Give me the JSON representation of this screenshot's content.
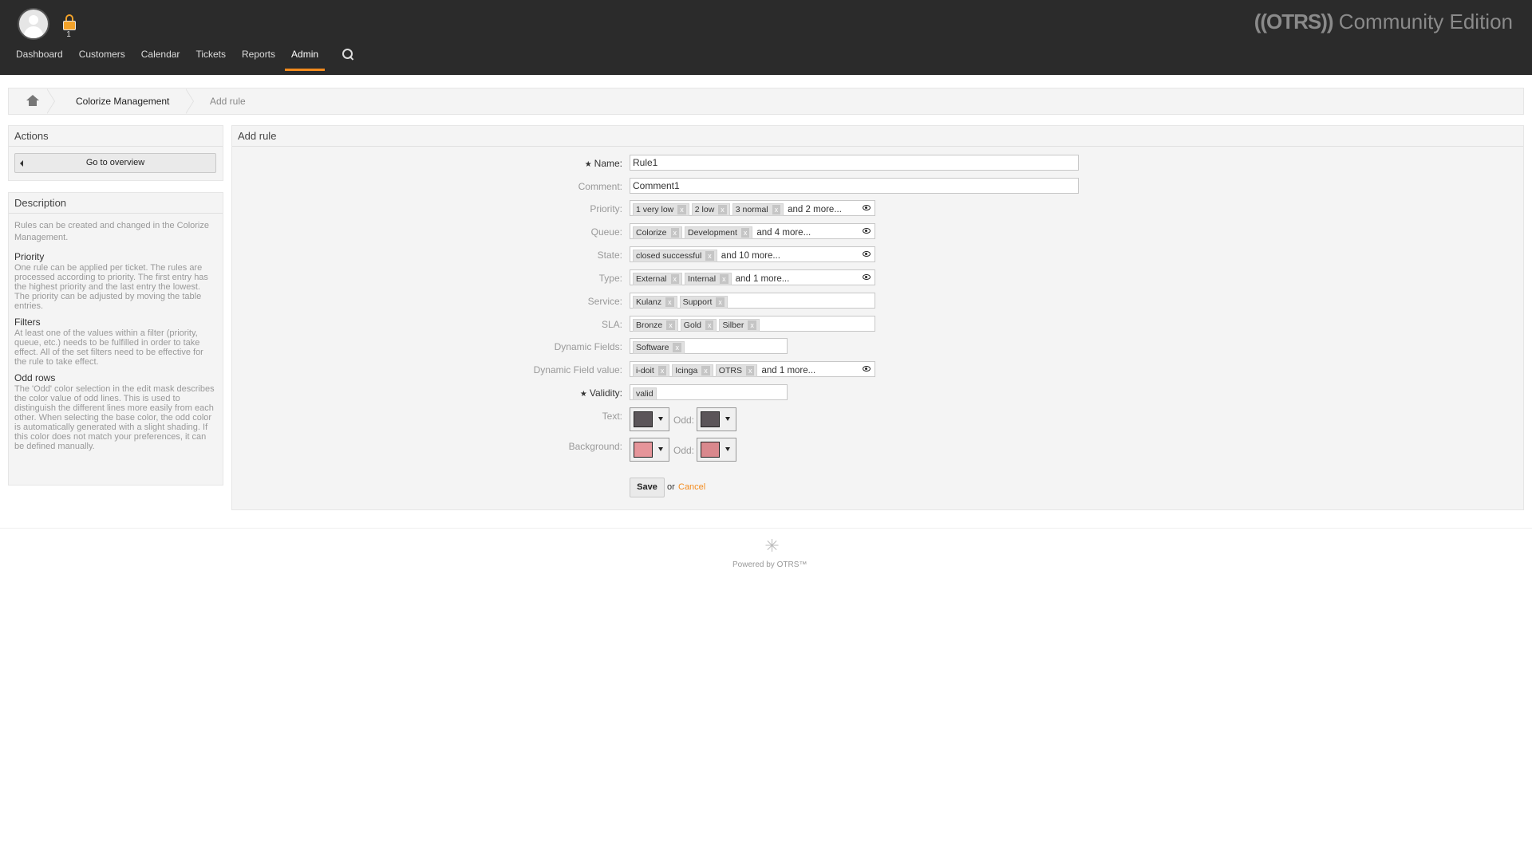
{
  "header": {
    "lock_count": "1",
    "logo_brand": "((OTRS))",
    "logo_edition": "Community Edition",
    "nav": [
      {
        "label": "Dashboard"
      },
      {
        "label": "Customers"
      },
      {
        "label": "Calendar"
      },
      {
        "label": "Tickets"
      },
      {
        "label": "Reports"
      },
      {
        "label": "Admin",
        "active": true
      }
    ]
  },
  "breadcrumb": {
    "link": "Colorize Management",
    "current": "Add rule"
  },
  "sidebar": {
    "actions_title": "Actions",
    "overview_button": "Go to overview",
    "description_title": "Description",
    "intro": "Rules can be created and changed in the Colorize Management.",
    "sections": [
      {
        "title": "Priority",
        "text": "One rule can be applied per ticket. The rules are processed according to priority. The first entry has the highest priority and the last entry the lowest. The priority can be adjusted by moving the table entries."
      },
      {
        "title": "Filters",
        "text": "At least one of the values within a filter (priority, queue, etc.) needs to be fulfilled in order to take effect. All of the set filters need to be effective for the rule to take effect."
      },
      {
        "title": "Odd rows",
        "text": "The 'Odd' color selection in the edit mask describes the color value of odd lines. This is used to distinguish the different lines more easily from each other. When selecting the base color, the odd color is automatically generated with a slight shading. If this color does not match your preferences, it can be defined manually."
      }
    ]
  },
  "main": {
    "title": "Add rule",
    "name_label": "Name:",
    "name_value": "Rule1",
    "comment_label": "Comment:",
    "comment_value": "Comment1",
    "priority_label": "Priority:",
    "priority_tags": [
      "1 very low",
      "2 low",
      "3 normal"
    ],
    "priority_more": "and 2 more...",
    "queue_label": "Queue:",
    "queue_tags": [
      "Colorize",
      "Development"
    ],
    "queue_more": "and 4 more...",
    "state_label": "State:",
    "state_tags": [
      "closed successful"
    ],
    "state_more": "and 10 more...",
    "type_label": "Type:",
    "type_tags": [
      "External",
      "Internal"
    ],
    "type_more": "and 1 more...",
    "service_label": "Service:",
    "service_tags": [
      "Kulanz",
      "Support"
    ],
    "sla_label": "SLA:",
    "sla_tags": [
      "Bronze",
      "Gold",
      "Silber"
    ],
    "dynfields_label": "Dynamic Fields:",
    "dynfields_tags": [
      "Software"
    ],
    "dynvalue_label": "Dynamic Field value:",
    "dynvalue_tags": [
      "i-doit",
      "Icinga",
      "OTRS"
    ],
    "dynvalue_more": "and 1 more...",
    "validity_label": "Validity:",
    "validity_tags": [
      "valid"
    ],
    "text_label": "Text:",
    "background_label": "Background:",
    "odd_label": "Odd:",
    "text_color": "#5b5559",
    "text_odd_color": "#5b5559",
    "bg_color": "#e6959a",
    "bg_odd_color": "#d9888d",
    "save_label": "Save",
    "or_label": "or",
    "cancel_label": "Cancel"
  },
  "footer": {
    "powered": "Powered by OTRS™"
  },
  "colors": {
    "accent": "#f38b1d",
    "topbar": "#2b2b2b"
  }
}
